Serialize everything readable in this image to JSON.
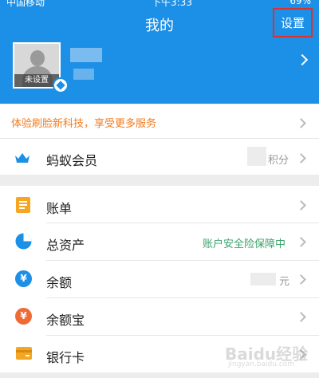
{
  "status_bar": {
    "carrier": "中国移动",
    "time": "下午3:33",
    "battery": "69%"
  },
  "header": {
    "title": "我的",
    "settings_label": "设置"
  },
  "profile": {
    "avatar_badge": "未设置"
  },
  "promo": {
    "text": "体验刷脸新科技，享受更多服务"
  },
  "membership": {
    "label": "蚂蚁会员",
    "points_label": "积分"
  },
  "menu": [
    {
      "label": "账单",
      "icon": "bill-icon"
    },
    {
      "label": "总资产",
      "icon": "assets-pie-icon",
      "note": "账户安全险保障中"
    },
    {
      "label": "余额",
      "icon": "balance-yuan-icon",
      "note": "元"
    },
    {
      "label": "余额宝",
      "icon": "yuebao-bag-icon"
    },
    {
      "label": "银行卡",
      "icon": "bank-card-icon"
    }
  ],
  "colors": {
    "header_blue": "#1c8fe6",
    "settings_highlight": "#e0302b",
    "promo_orange": "#f47a1f",
    "insurance_green": "#3aa36c"
  },
  "watermark": {
    "text": "Baidu经验",
    "sub": "jingyan.baidu.com"
  }
}
